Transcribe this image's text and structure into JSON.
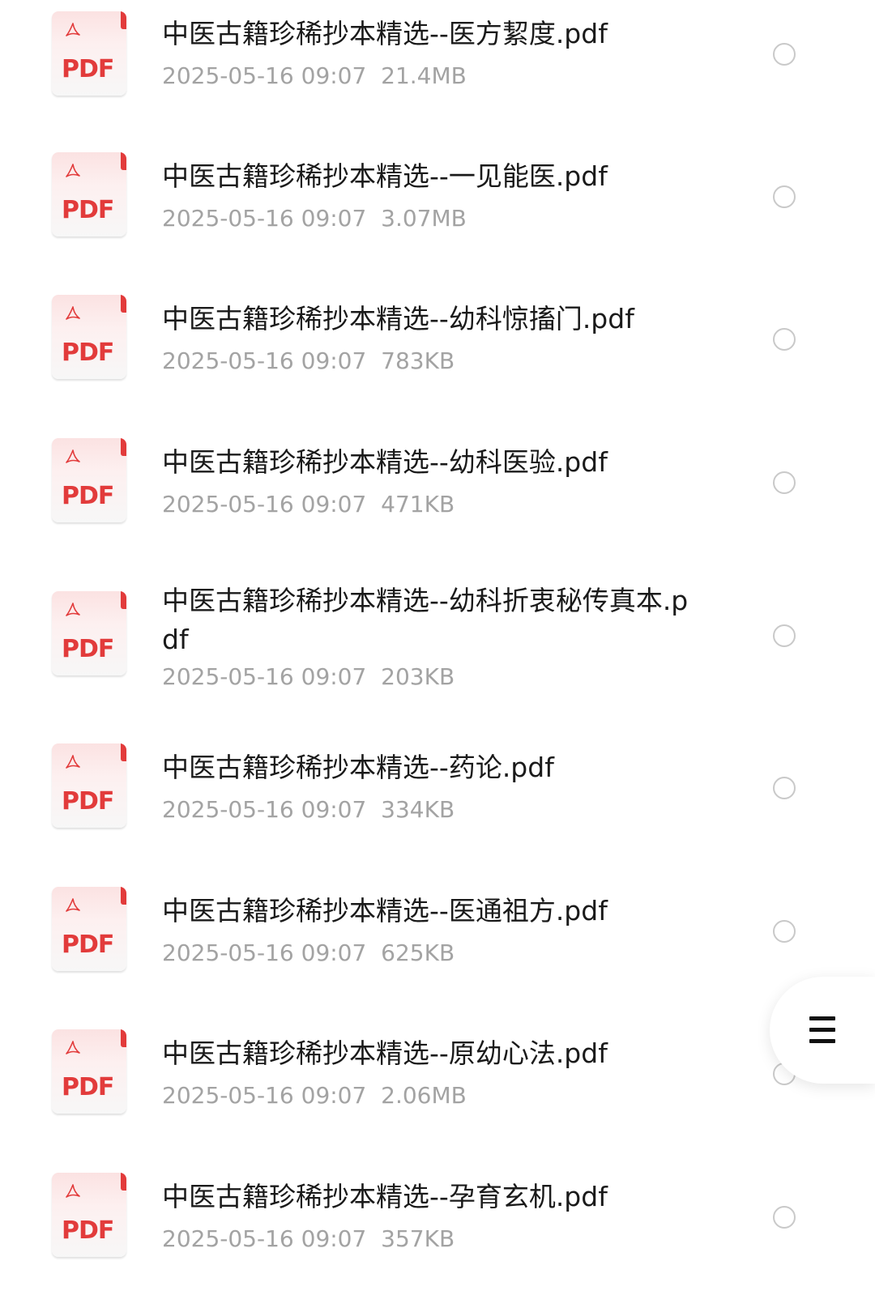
{
  "files": [
    {
      "name": "中医古籍珍稀抄本精选--医方絜度.pdf",
      "date": "2025-05-16 09:07",
      "size": "21.4MB",
      "icon": "pdf-file-icon"
    },
    {
      "name": "中医古籍珍稀抄本精选--一见能医.pdf",
      "date": "2025-05-16 09:07",
      "size": "3.07MB",
      "icon": "pdf-file-icon"
    },
    {
      "name": "中医古籍珍稀抄本精选--幼科惊搐门.pdf",
      "date": "2025-05-16 09:07",
      "size": "783KB",
      "icon": "pdf-file-icon"
    },
    {
      "name": "中医古籍珍稀抄本精选--幼科医验.pdf",
      "date": "2025-05-16 09:07",
      "size": "471KB",
      "icon": "pdf-file-icon"
    },
    {
      "name": "中医古籍珍稀抄本精选--幼科折衷秘传真本.pdf",
      "date": "2025-05-16 09:07",
      "size": "203KB",
      "icon": "pdf-file-icon"
    },
    {
      "name": "中医古籍珍稀抄本精选--药论.pdf",
      "date": "2025-05-16 09:07",
      "size": "334KB",
      "icon": "pdf-file-icon"
    },
    {
      "name": "中医古籍珍稀抄本精选--医通祖方.pdf",
      "date": "2025-05-16 09:07",
      "size": "625KB",
      "icon": "pdf-file-icon"
    },
    {
      "name": "中医古籍珍稀抄本精选--原幼心法.pdf",
      "date": "2025-05-16 09:07",
      "size": "2.06MB",
      "icon": "pdf-file-icon"
    },
    {
      "name": "中医古籍珍稀抄本精选--孕育玄机.pdf",
      "date": "2025-05-16 09:07",
      "size": "357KB",
      "icon": "pdf-file-icon"
    }
  ],
  "pdf_icon_label": "PDF",
  "colors": {
    "pdf_red": "#e23b3b",
    "title_text": "#1a1a1a",
    "meta_text": "#a3a3a3",
    "radio_border": "#c9c9c9"
  },
  "fab": {
    "icon": "menu-icon"
  }
}
